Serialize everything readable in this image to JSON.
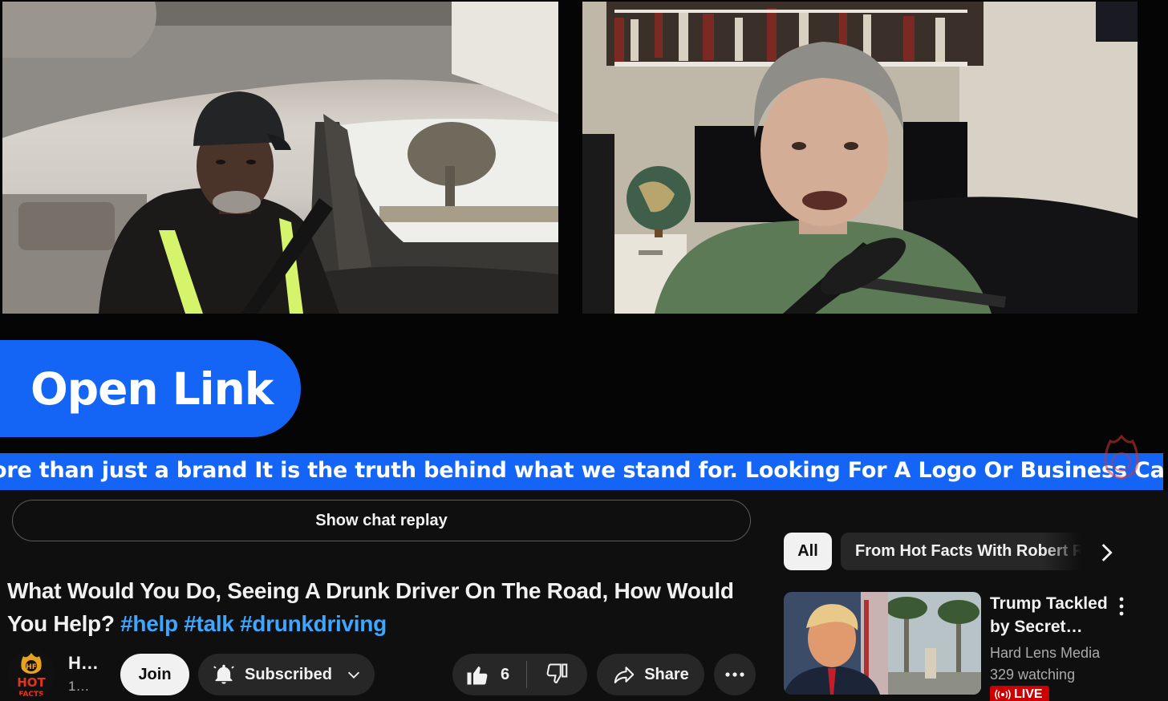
{
  "video": {
    "overlay_button": "Open Link",
    "ticker": "ore than just a brand It is the truth behind what we stand for. Looking For A Logo Or Business Cards Or An"
  },
  "chat_replay_label": "Show chat replay",
  "title": {
    "text": "What Would You Do, Seeing A Drunk Driver On The Road, How Would You Help?",
    "hashtags": [
      "#help",
      "#talk",
      "#drunkdriving"
    ]
  },
  "channel": {
    "name": "H…",
    "subscribers": "1…",
    "avatar_text": "HOT",
    "avatar_sub": "FACTS"
  },
  "actions": {
    "join": "Join",
    "subscribed": "Subscribed",
    "likes": "6",
    "share": "Share"
  },
  "chips": {
    "all": "All",
    "from": "From Hot Facts With Robert R"
  },
  "recommended": {
    "title": "Trump Tackled by Secret…",
    "channel": "Hard Lens Media",
    "watching": "329 watching",
    "badge": "LIVE"
  },
  "colors": {
    "accent_blue": "#1465f5",
    "link_blue": "#3ea6ff",
    "live_red": "#cc0000",
    "background": "#0f0f0f"
  }
}
